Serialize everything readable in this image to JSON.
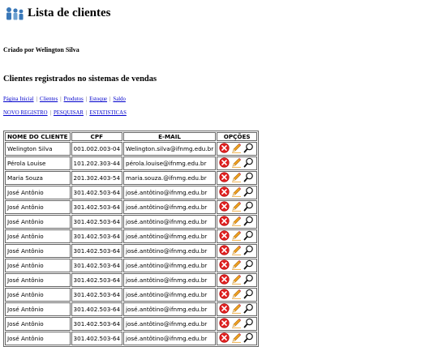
{
  "page": {
    "title": "Lista de clientes",
    "author": "Criado por Welington Silva",
    "subtitle": "Clientes registrados no sistemas de vendas"
  },
  "nav": {
    "items": [
      "Página Inicial",
      "Clientes",
      "Produtos",
      "Estoque",
      "Saldo"
    ]
  },
  "actions": {
    "items": [
      "NOVO REGISTRO",
      "PESQUISAR",
      "ESTATISTICAS"
    ]
  },
  "table": {
    "headers": [
      "NOME DO CLIENTE",
      "CPF",
      "E-MAIL",
      "OPÇÕES"
    ],
    "rows": [
      [
        "Welington Silva",
        "001.002.003-04",
        "Welington.silva@ifnmg.edu.br"
      ],
      [
        "Pérola Louise",
        "101.202.303-44",
        "pérola.louise@ifnmg.edu.br"
      ],
      [
        "Maria Souza",
        "201.302.403-54",
        "maria.souza.@ifnmg.edu.br"
      ],
      [
        "José Antônio",
        "301.402.503-64",
        "josé.antôtino@ifnmg.edu.br"
      ],
      [
        "José Antônio",
        "301.402.503-64",
        "josé.antôtino@ifnmg.edu.br"
      ],
      [
        "José Antônio",
        "301.402.503-64",
        "josé.antôtino@ifnmg.edu.br"
      ],
      [
        "José Antônio",
        "301.402.503-64",
        "josé.antôtino@ifnmg.edu.br"
      ],
      [
        "José Antônio",
        "301.402.503-64",
        "josé.antôtino@ifnmg.edu.br"
      ],
      [
        "José Antônio",
        "301.402.503-64",
        "josé.antôtino@ifnmg.edu.br"
      ],
      [
        "José Antônio",
        "301.402.503-64",
        "josé.antôtino@ifnmg.edu.br"
      ],
      [
        "José Antônio",
        "301.402.503-64",
        "josé.antôtino@ifnmg.edu.br"
      ],
      [
        "José Antônio",
        "301.402.503-64",
        "josé.antôtino@ifnmg.edu.br"
      ],
      [
        "José Antônio",
        "301.402.503-64",
        "josé.antôtino@ifnmg.edu.br"
      ],
      [
        "José Antônio",
        "301.402.503-64",
        "josé.antôtino@ifnmg.edu.br"
      ]
    ],
    "row_icons": [
      "delete-icon",
      "edit-icon",
      "view-icon"
    ]
  },
  "colors": {
    "link": "#0000cc",
    "delete": "#e02020",
    "pencil": "#f0a020",
    "people_icon": "#3a78b8"
  }
}
